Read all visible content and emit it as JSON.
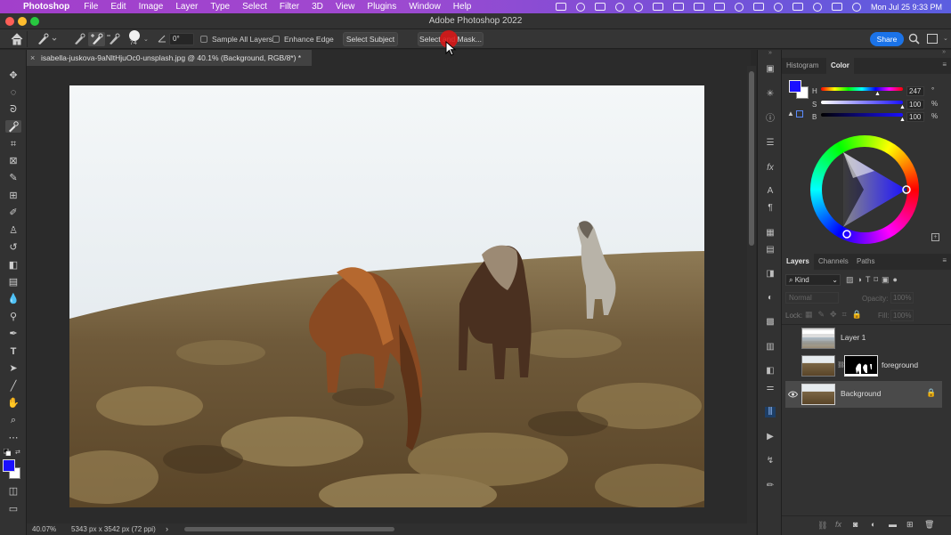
{
  "menubar": {
    "app_name": "Photoshop",
    "items": [
      "File",
      "Edit",
      "Image",
      "Layer",
      "Type",
      "Select",
      "Filter",
      "3D",
      "View",
      "Plugins",
      "Window",
      "Help"
    ],
    "datetime": "Mon Jul 25  9:33 PM"
  },
  "window": {
    "title": "Adobe Photoshop 2022"
  },
  "options": {
    "brush_size": "74",
    "angle": "0°",
    "sample_all_layers": "Sample All Layers",
    "enhance_edge": "Enhance Edge",
    "select_subject": "Select Subject",
    "select_and_mask": "Select and Mask...",
    "share": "Share"
  },
  "document": {
    "tab_title": "isabella-juskova-9aNltHjuOc0-unsplash.jpg @ 40.1% (Background, RGB/8*) *",
    "zoom": "40.07%",
    "dimensions": "5343 px x 3542 px (72 ppi)"
  },
  "color_panel": {
    "tabs": [
      "Histogram",
      "Color"
    ],
    "active_tab": "Color",
    "h_label": "H",
    "h_value": "247",
    "h_unit": "°",
    "s_label": "S",
    "s_value": "100",
    "s_unit": "%",
    "b_label": "B",
    "b_value": "100",
    "b_unit": "%",
    "foreground_color": "#1a10ff",
    "background_color": "#ffffff"
  },
  "layers_panel": {
    "tabs": [
      "Layers",
      "Channels",
      "Paths"
    ],
    "active_tab": "Layers",
    "filter_label": "Kind",
    "blend_mode": "Normal",
    "opacity_label": "Opacity:",
    "opacity_value": "100%",
    "lock_label": "Lock:",
    "fill_label": "Fill:",
    "fill_value": "100%",
    "layers": [
      {
        "name": "Layer 1",
        "visible": false,
        "selected": false
      },
      {
        "name": "foreground",
        "visible": false,
        "selected": false,
        "has_mask": true
      },
      {
        "name": "Background",
        "visible": true,
        "selected": true,
        "locked": true
      }
    ]
  }
}
